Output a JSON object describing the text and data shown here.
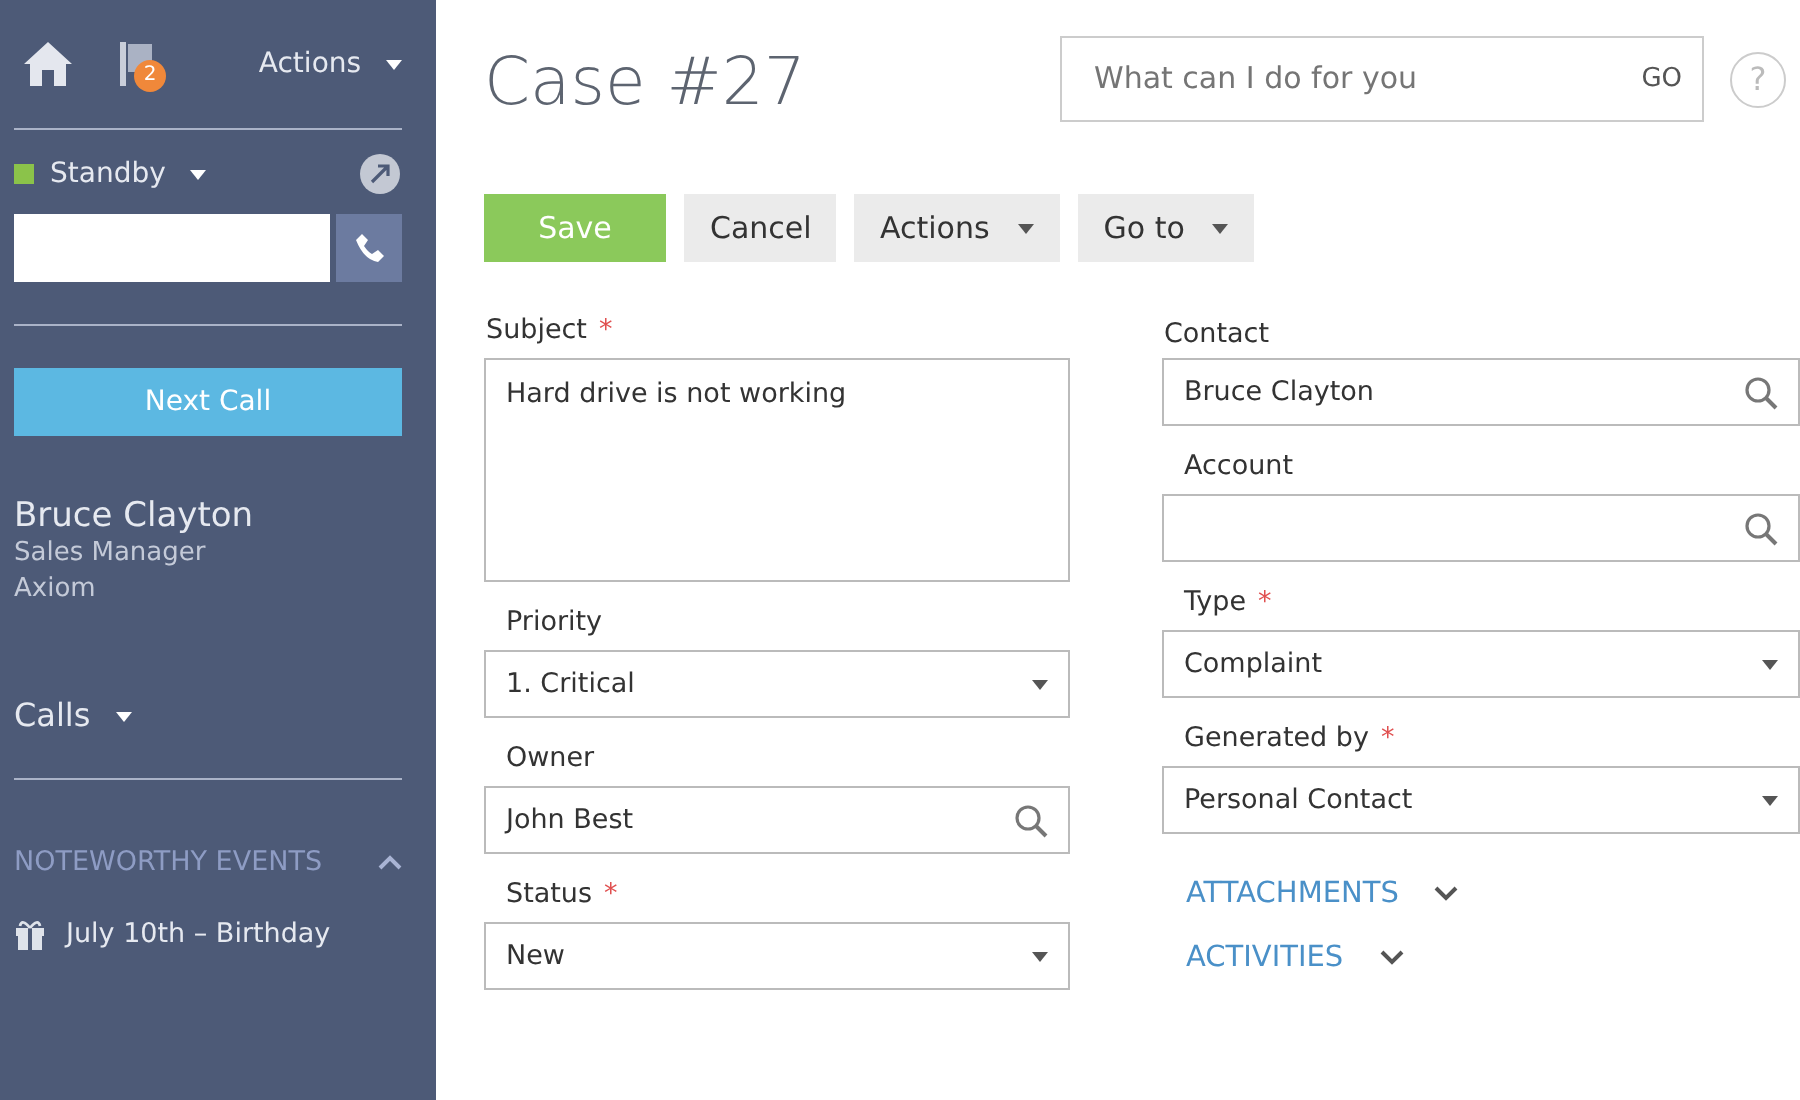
{
  "sidebar": {
    "nav": {
      "badge": "2",
      "actions": "Actions"
    },
    "status": {
      "label": "Standby",
      "color": "#8bc34a"
    },
    "next_call": "Next Call",
    "contact": {
      "name": "Bruce Clayton",
      "title": "Sales Manager",
      "company": "Axiom"
    },
    "calls": {
      "label": "Calls",
      "expanded": false
    },
    "events": {
      "title": "NOTEWORTHY EVENTS",
      "expanded": true,
      "items": [
        {
          "text": "July 10th – Birthday"
        }
      ]
    }
  },
  "header": {
    "title": "Case #27",
    "search": {
      "placeholder": "What can I do for you",
      "go": "GO"
    },
    "help": "?"
  },
  "toolbar": [
    {
      "label": "Save",
      "kind": "primary"
    },
    {
      "label": "Cancel",
      "kind": "plain"
    },
    {
      "label": "Actions",
      "kind": "menu"
    },
    {
      "label": "Go to",
      "kind": "menu"
    }
  ],
  "form": {
    "left": [
      {
        "label": "Subject",
        "required_mark": "*",
        "kind": "textarea",
        "value": "Hard drive is not working"
      },
      {
        "label": "Priority",
        "kind": "select",
        "value": "1. Critical"
      },
      {
        "label": "Owner",
        "kind": "lookup",
        "value": "John Best"
      },
      {
        "label": "Status",
        "required_mark": "*",
        "kind": "select",
        "value": "New"
      }
    ],
    "right": [
      {
        "label": "Contact",
        "kind": "lookup",
        "value": "Bruce Clayton"
      },
      {
        "label": "Account",
        "kind": "lookup"
      },
      {
        "label": "Type",
        "required_mark": "*",
        "kind": "select",
        "value": "Complaint"
      },
      {
        "label": "Generated by",
        "required_mark": "*",
        "kind": "select",
        "value": "Personal Contact"
      }
    ]
  },
  "sections": [
    {
      "label": "ATTACHMENTS",
      "expanded": false
    },
    {
      "label": "ACTIVITIES",
      "expanded": false
    }
  ]
}
